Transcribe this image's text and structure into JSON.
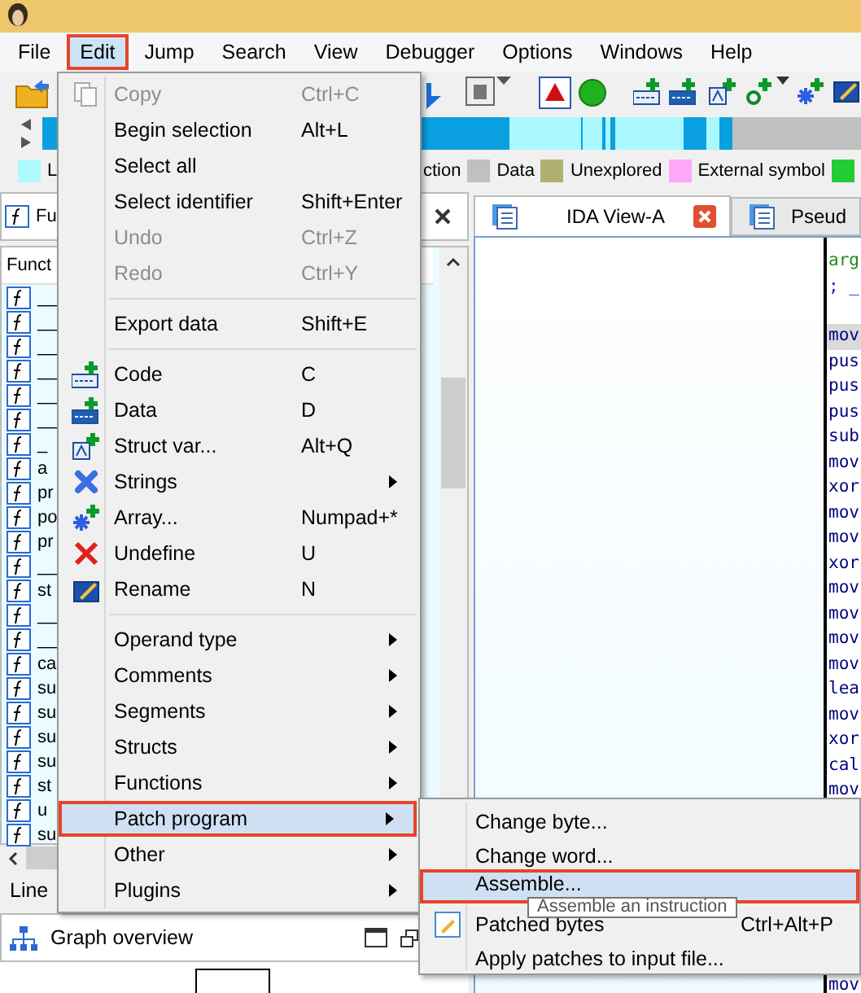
{
  "menu_bar": [
    {
      "label": "File",
      "selected": false
    },
    {
      "label": "Edit",
      "selected": true
    },
    {
      "label": "Jump",
      "selected": false
    },
    {
      "label": "Search",
      "selected": false
    },
    {
      "label": "View",
      "selected": false
    },
    {
      "label": "Debugger",
      "selected": false
    },
    {
      "label": "Options",
      "selected": false
    },
    {
      "label": "Windows",
      "selected": false
    },
    {
      "label": "Help",
      "selected": false
    }
  ],
  "legend": [
    {
      "label": "L",
      "color": "#aefcff"
    },
    {
      "label": "ction"
    },
    {
      "label": "Data",
      "color": "#c0c0c0"
    },
    {
      "label": "Unexplored",
      "color": "#b0b070"
    },
    {
      "label": "External symbol",
      "color": "#ffa8f8"
    },
    {
      "color": "#22cc33"
    }
  ],
  "functions_panel": {
    "tab": "Fu",
    "header": "Funct",
    "rows": [
      "__",
      "__",
      "__",
      "__",
      "__",
      "__",
      "_",
      "a",
      "pr",
      "po",
      "pr",
      "__",
      "st",
      "__",
      "__",
      "ca",
      "su",
      "su",
      "su",
      "su",
      "st",
      "u",
      "su"
    ],
    "status": "Line"
  },
  "graph_overview": {
    "title": "Graph overview"
  },
  "tabs": [
    {
      "label": "IDA View-A",
      "selected": true
    },
    {
      "label": "Pseud",
      "selected": false
    }
  ],
  "code_lines": [
    {
      "text": "arg",
      "kind": "name",
      "selected": false
    },
    {
      "text": "; _",
      "kind": "comment",
      "selected": false
    },
    {
      "text": "mov",
      "kind": "insn",
      "selected": true
    },
    {
      "text": "pus",
      "kind": "insn",
      "selected": false
    },
    {
      "text": "pus",
      "kind": "insn",
      "selected": false
    },
    {
      "text": "pus",
      "kind": "insn",
      "selected": false
    },
    {
      "text": "sub",
      "kind": "insn",
      "selected": false
    },
    {
      "text": "mov",
      "kind": "insn",
      "selected": false
    },
    {
      "text": "xor",
      "kind": "insn",
      "selected": false
    },
    {
      "text": "mov",
      "kind": "insn",
      "selected": false
    },
    {
      "text": "mov",
      "kind": "insn",
      "selected": false
    },
    {
      "text": "xor",
      "kind": "insn",
      "selected": false
    },
    {
      "text": "mov",
      "kind": "insn",
      "selected": false
    },
    {
      "text": "mov",
      "kind": "insn",
      "selected": false
    },
    {
      "text": "mov",
      "kind": "insn",
      "selected": false
    },
    {
      "text": "mov",
      "kind": "insn",
      "selected": false
    },
    {
      "text": "lea",
      "kind": "insn",
      "selected": false
    },
    {
      "text": "mov",
      "kind": "insn",
      "selected": false
    },
    {
      "text": "xor",
      "kind": "insn",
      "selected": false
    },
    {
      "text": "cal",
      "kind": "insn",
      "selected": false
    },
    {
      "text": "mov",
      "kind": "insn",
      "selected": false
    }
  ],
  "code_last_line": {
    "text": "mov",
    "kind": "insn"
  },
  "edit_menu": [
    {
      "kind": "item",
      "label": "Copy",
      "shortcut": "Ctrl+C",
      "disabled": true,
      "submenu": false,
      "selected": false
    },
    {
      "kind": "item",
      "label": "Begin selection",
      "shortcut": "Alt+L",
      "disabled": false,
      "submenu": false,
      "selected": false
    },
    {
      "kind": "item",
      "label": "Select all",
      "disabled": false,
      "submenu": false,
      "selected": false
    },
    {
      "kind": "item",
      "label": "Select identifier",
      "shortcut": "Shift+Enter",
      "disabled": false,
      "submenu": false,
      "selected": false
    },
    {
      "kind": "item",
      "label": "Undo",
      "shortcut": "Ctrl+Z",
      "disabled": true,
      "submenu": false,
      "selected": false
    },
    {
      "kind": "item",
      "label": "Redo",
      "shortcut": "Ctrl+Y",
      "disabled": true,
      "submenu": false,
      "selected": false
    },
    {
      "kind": "separator"
    },
    {
      "kind": "item",
      "label": "Export data",
      "shortcut": "Shift+E",
      "disabled": false,
      "submenu": false,
      "selected": false
    },
    {
      "kind": "separator"
    },
    {
      "kind": "item",
      "label": "Code",
      "shortcut": "C",
      "disabled": false,
      "submenu": false,
      "selected": false
    },
    {
      "kind": "item",
      "label": "Data",
      "shortcut": "D",
      "disabled": false,
      "submenu": false,
      "selected": false
    },
    {
      "kind": "item",
      "label": "Struct var...",
      "shortcut": "Alt+Q",
      "disabled": false,
      "submenu": false,
      "selected": false
    },
    {
      "kind": "item",
      "label": "Strings",
      "disabled": false,
      "submenu": true,
      "selected": false
    },
    {
      "kind": "item",
      "label": "Array...",
      "shortcut": "Numpad+*",
      "disabled": false,
      "submenu": false,
      "selected": false
    },
    {
      "kind": "item",
      "label": "Undefine",
      "shortcut": "U",
      "disabled": false,
      "submenu": false,
      "selected": false
    },
    {
      "kind": "item",
      "label": "Rename",
      "shortcut": "N",
      "disabled": false,
      "submenu": false,
      "selected": false
    },
    {
      "kind": "separator"
    },
    {
      "kind": "item",
      "label": "Operand type",
      "disabled": false,
      "submenu": true,
      "selected": false
    },
    {
      "kind": "item",
      "label": "Comments",
      "disabled": false,
      "submenu": true,
      "selected": false
    },
    {
      "kind": "item",
      "label": "Segments",
      "disabled": false,
      "submenu": true,
      "selected": false
    },
    {
      "kind": "item",
      "label": "Structs",
      "disabled": false,
      "submenu": true,
      "selected": false
    },
    {
      "kind": "item",
      "label": "Functions",
      "disabled": false,
      "submenu": true,
      "selected": false
    },
    {
      "kind": "item",
      "label": "Patch program",
      "disabled": false,
      "submenu": true,
      "selected": true
    },
    {
      "kind": "item",
      "label": "Other",
      "disabled": false,
      "submenu": true,
      "selected": false
    },
    {
      "kind": "item",
      "label": "Plugins",
      "disabled": false,
      "submenu": true,
      "selected": false
    }
  ],
  "patch_submenu": [
    {
      "label": "Change byte...",
      "selected": false
    },
    {
      "label": "Change word...",
      "selected": false
    },
    {
      "label": "Assemble...",
      "selected": true
    },
    {
      "label": "Patched bytes",
      "shortcut": "Ctrl+Alt+P",
      "selected": false
    },
    {
      "label": "Apply patches to input file...",
      "selected": false
    }
  ],
  "tooltip": "Assemble an instruction"
}
